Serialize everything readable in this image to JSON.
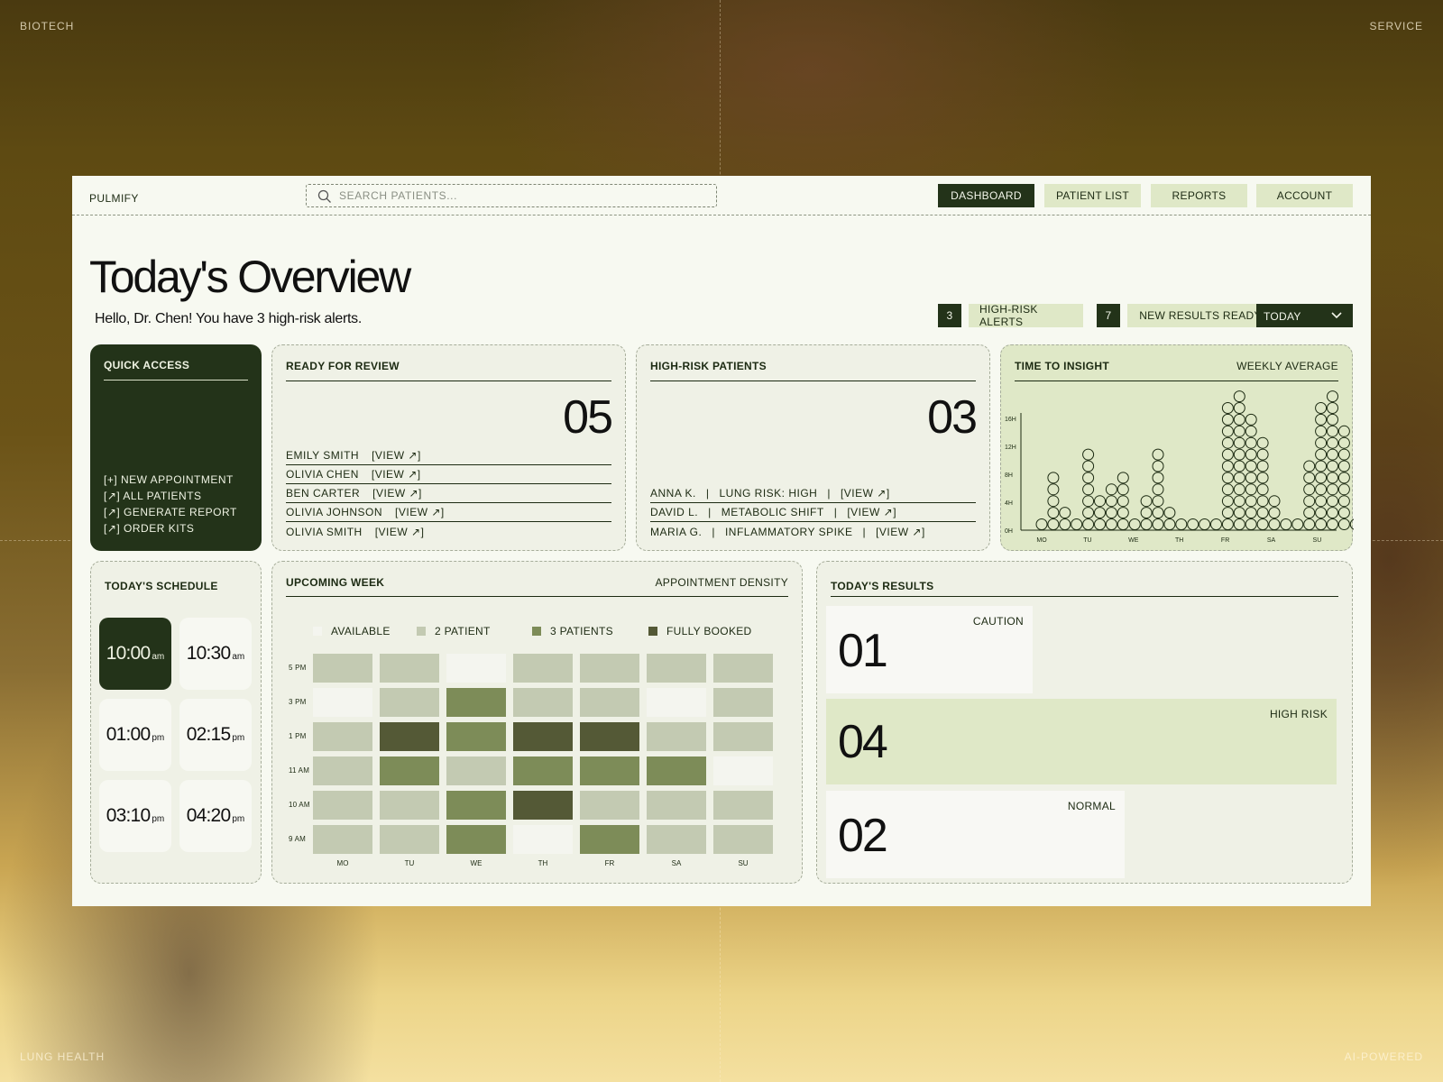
{
  "corners": {
    "top_left": "BIOTECH",
    "top_right": "SERVICE",
    "bottom_left": "LUNG HEALTH",
    "bottom_right": "AI-POWERED"
  },
  "brand": "PULMIFY",
  "search": {
    "placeholder": "SEARCH PATIENTS...",
    "value": ""
  },
  "nav": {
    "items": [
      "DASHBOARD",
      "PATIENT LIST",
      "REPORTS",
      "ACCOUNT"
    ],
    "active": "DASHBOARD"
  },
  "page": {
    "title": "Today's Overview",
    "greeting": "Hello, Dr. Chen! You have 3 high-risk alerts."
  },
  "stats": {
    "alerts": {
      "count": "3",
      "label": "HIGH-RISK ALERTS"
    },
    "results": {
      "count": "7",
      "label": "NEW RESULTS READY"
    },
    "range": "TODAY"
  },
  "quick_access": {
    "title": "QUICK ACCESS",
    "items": [
      "[+] NEW APPOINTMENT",
      "[↗] ALL PATIENTS",
      "[↗] GENERATE REPORT",
      "[↗] ORDER KITS"
    ]
  },
  "review": {
    "title": "READY FOR REVIEW",
    "count": "05",
    "patients": [
      {
        "name": "EMILY SMITH",
        "action": "[VIEW ↗]"
      },
      {
        "name": "OLIVIA CHEN",
        "action": "[VIEW ↗]"
      },
      {
        "name": "BEN CARTER",
        "action": "[VIEW ↗]"
      },
      {
        "name": "OLIVIA JOHNSON",
        "action": "[VIEW ↗]"
      },
      {
        "name": "OLIVIA SMITH",
        "action": "[VIEW ↗]"
      }
    ]
  },
  "high_risk": {
    "title": "HIGH-RISK PATIENTS",
    "count": "03",
    "patients": [
      {
        "name": "ANNA K.",
        "sep": "|",
        "note": "LUNG RISK: HIGH",
        "action": "[VIEW ↗]"
      },
      {
        "name": "DAVID L.",
        "sep": "|",
        "note": "METABOLIC SHIFT",
        "action": "[VIEW ↗]"
      },
      {
        "name": "MARIA G.",
        "sep": "|",
        "note": "INFLAMMATORY SPIKE",
        "action": "[VIEW ↗]"
      }
    ]
  },
  "insight": {
    "title": "TIME TO INSIGHT",
    "subtitle": "WEEKLY AVERAGE",
    "chart_data": {
      "type": "scatter",
      "y_ticks": [
        "0H",
        "4H",
        "8H",
        "12H",
        "16H"
      ],
      "ylim": [
        0,
        16
      ],
      "x_ticks": [
        "MO",
        "TU",
        "WE",
        "TH",
        "FR",
        "SA",
        "SU"
      ],
      "column_counts": [
        1,
        5,
        2,
        1,
        7,
        3,
        4,
        5,
        1,
        3,
        7,
        2,
        1,
        1,
        1,
        1,
        11,
        12,
        10,
        8,
        3,
        1,
        1,
        6,
        11,
        12,
        9,
        1
      ]
    }
  },
  "schedule": {
    "title": "TODAY'S SCHEDULE",
    "slots": [
      {
        "time": "10:00",
        "ampm": "am"
      },
      {
        "time": "10:30",
        "ampm": "am"
      },
      {
        "time": "01:00",
        "ampm": "pm"
      },
      {
        "time": "02:15",
        "ampm": "pm"
      },
      {
        "time": "03:10",
        "ampm": "pm"
      },
      {
        "time": "04:20",
        "ampm": "pm"
      }
    ],
    "selected": 0
  },
  "week": {
    "title": "UPCOMING WEEK",
    "subtitle": "APPOINTMENT DENSITY",
    "legend": [
      "AVAILABLE",
      "2 PATIENT",
      "3 PATIENTS",
      "FULLY BOOKED"
    ],
    "colors": [
      "#f4f5ef",
      "#c3cab2",
      "#7d8c58",
      "#545936"
    ],
    "chart_data": {
      "type": "heatmap",
      "rows": [
        "5 PM",
        "3 PM",
        "1 PM",
        "11 AM",
        "10 AM",
        "9 AM"
      ],
      "cols": [
        "MO",
        "TU",
        "WE",
        "TH",
        "FR",
        "SA",
        "SU"
      ],
      "levels": [
        [
          1,
          1,
          0,
          1,
          1,
          1,
          1
        ],
        [
          0,
          1,
          2,
          1,
          1,
          0,
          1
        ],
        [
          1,
          3,
          2,
          3,
          3,
          1,
          1
        ],
        [
          1,
          2,
          1,
          2,
          2,
          2,
          0
        ],
        [
          1,
          1,
          2,
          3,
          1,
          1,
          1
        ],
        [
          1,
          1,
          2,
          0,
          2,
          1,
          1
        ]
      ]
    }
  },
  "results": {
    "title": "TODAY'S RESULTS",
    "items": [
      {
        "number": "01",
        "label": "CAUTION"
      },
      {
        "number": "04",
        "label": "HIGH RISK"
      },
      {
        "number": "02",
        "label": "NORMAL"
      }
    ]
  }
}
